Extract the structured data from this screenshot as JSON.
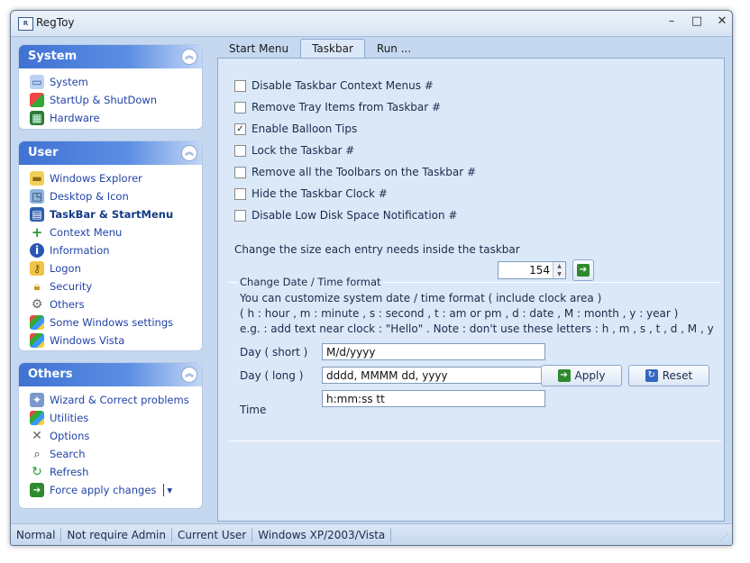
{
  "window": {
    "title": "RegToy",
    "app_icon": "R",
    "controls": [
      "–",
      "□",
      "✕"
    ]
  },
  "sidebar": {
    "system": {
      "title": "System",
      "collapse": "︽",
      "items": [
        {
          "label": "System",
          "icon": "computer-icon"
        },
        {
          "label": "StartUp & ShutDown",
          "icon": "windows-flag-icon"
        },
        {
          "label": "Hardware",
          "icon": "chip-icon"
        }
      ]
    },
    "user": {
      "title": "User",
      "collapse": "︽",
      "items": [
        {
          "label": "Windows Explorer",
          "icon": "folder-icon"
        },
        {
          "label": "Desktop & Icon",
          "icon": "desktop-icon"
        },
        {
          "label": "TaskBar & StartMenu",
          "icon": "taskbar-icon"
        },
        {
          "label": "Context Menu",
          "icon": "plus-icon"
        },
        {
          "label": "Information",
          "icon": "info-icon"
        },
        {
          "label": "Logon",
          "icon": "key-icon"
        },
        {
          "label": "Security",
          "icon": "lock-icon"
        },
        {
          "label": "Others",
          "icon": "gear-icon"
        },
        {
          "label": "Some Windows settings",
          "icon": "windows-flag-icon"
        },
        {
          "label": "Windows Vista",
          "icon": "windows-flag-icon"
        }
      ]
    },
    "others": {
      "title": "Others",
      "collapse": "︽",
      "items": [
        {
          "label": "Wizard & Correct problems",
          "icon": "wizard-icon"
        },
        {
          "label": "Utilities",
          "icon": "windows-flag-icon"
        },
        {
          "label": "Options",
          "icon": "tools-icon"
        },
        {
          "label": "Search",
          "icon": "search-icon"
        },
        {
          "label": "Refresh",
          "icon": "refresh-icon"
        },
        {
          "label": "Force apply changes",
          "icon": "arrow-right-icon"
        }
      ],
      "force_dropdown": "▾"
    }
  },
  "tabs": [
    "Start Menu",
    "Taskbar",
    "Run ..."
  ],
  "checkboxes": [
    {
      "label": "Disable Taskbar Context Menus #",
      "checked": false
    },
    {
      "label": "Remove Tray Items from Taskbar #",
      "checked": false
    },
    {
      "label": "Enable Balloon Tips",
      "checked": true
    },
    {
      "label": "Lock the Taskbar #",
      "checked": false
    },
    {
      "label": "Remove all the Toolbars on the Taskbar #",
      "checked": false
    },
    {
      "label": "Hide the Taskbar Clock #",
      "checked": false
    },
    {
      "label": "Disable Low Disk Space Notification #",
      "checked": false
    }
  ],
  "entry_size": {
    "label": "Change the size each entry needs inside the taskbar",
    "value": "154"
  },
  "date_time": {
    "group_title": "Change Date / Time format",
    "info1": "You can customize system date / time format ( include clock area )",
    "info2": "( h : hour , m : minute , s : second , t : am or pm , d : date , M : month , y : year )",
    "info3": "e.g.  : add text near clock : \"Hello\" . Note : don't use these letters : h , m , s , t , d , M , y",
    "short_label": "Day ( short )",
    "short_value": "M/d/yyyy",
    "long_label": "Day ( long )",
    "long_value": "dddd, MMMM dd, yyyy",
    "time_label": "Time",
    "time_value": "h:mm:ss tt",
    "apply": "Apply",
    "reset": "Reset"
  },
  "status": [
    "Normal",
    "Not require Admin",
    "Current User",
    "Windows XP/2003/Vista"
  ],
  "colors": {
    "accent": "#3f72d2",
    "link": "#2243a6",
    "panel_bg": "#dbe8f8"
  }
}
